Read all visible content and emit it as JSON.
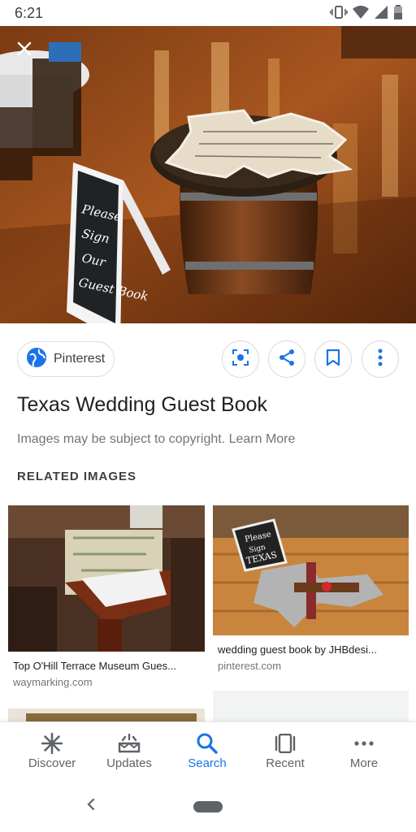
{
  "status_bar": {
    "time": "6:21",
    "icons": [
      "vibrate-icon",
      "wifi-icon",
      "signal-icon",
      "battery-icon"
    ]
  },
  "hero": {
    "close_icon": "close-icon"
  },
  "actions": {
    "source_label": "Pinterest",
    "source_icon": "globe-icon",
    "buttons": [
      "lens-icon",
      "share-icon",
      "bookmark-icon",
      "more-vert-icon"
    ]
  },
  "title": "Texas Wedding Guest Book",
  "copyright_text": "Images may be subject to copyright.",
  "learn_more": "Learn More",
  "related_heading": "RELATED IMAGES",
  "related": [
    {
      "caption": "Top O'Hill Terrace Museum Gues...",
      "source": "waymarking.com"
    },
    {
      "caption": "wedding guest book by JHBdesi...",
      "source": "pinterest.com"
    }
  ],
  "nav": {
    "items": [
      {
        "label": "Discover",
        "icon": "asterisk-icon"
      },
      {
        "label": "Updates",
        "icon": "updates-icon"
      },
      {
        "label": "Search",
        "icon": "search-icon"
      },
      {
        "label": "Recent",
        "icon": "recent-icon"
      },
      {
        "label": "More",
        "icon": "more-horiz-icon"
      }
    ],
    "active": "Search"
  },
  "colors": {
    "accent": "#1a73e8",
    "text": "#202124",
    "secondary": "#70757a",
    "border": "#dadce0"
  }
}
